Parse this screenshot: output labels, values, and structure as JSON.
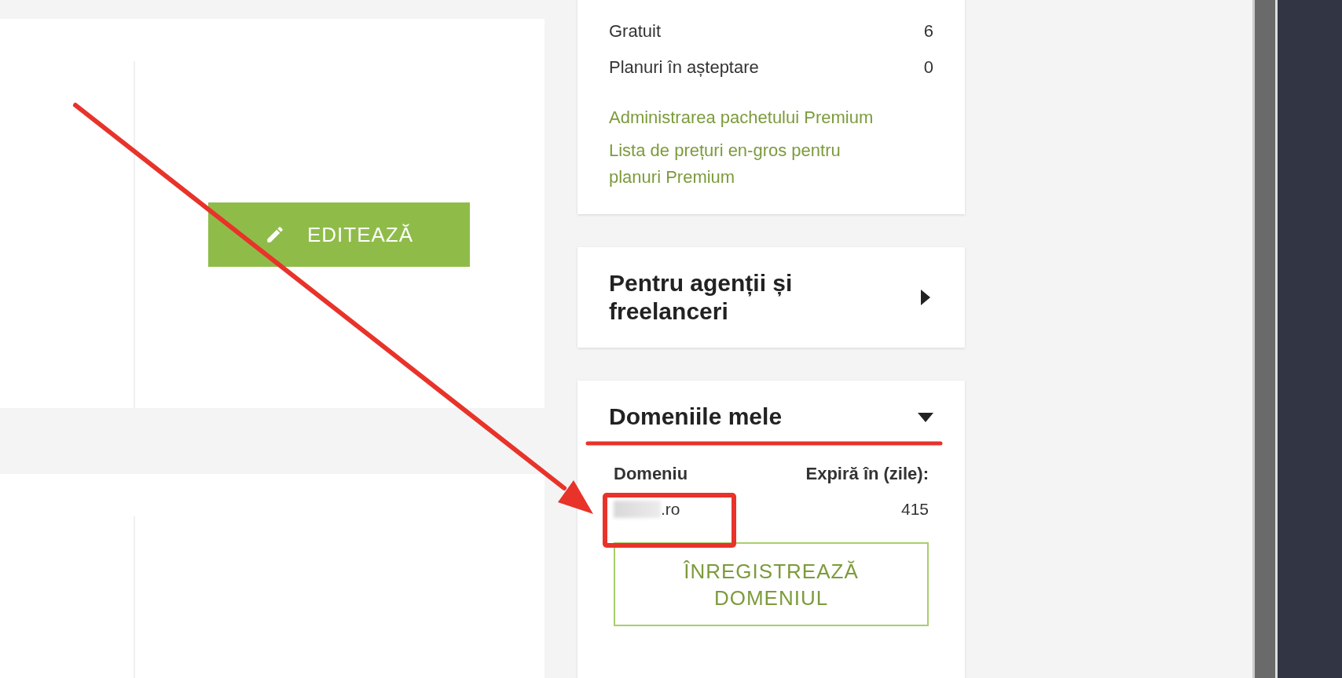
{
  "main_card": {
    "edit_button": "EDITEAZĂ"
  },
  "plans_card": {
    "rows": [
      {
        "label": "Gratuit",
        "value": "6"
      },
      {
        "label": "Planuri în așteptare",
        "value": "0"
      }
    ],
    "links": [
      "Administrarea pachetului Premium",
      "Lista de prețuri en-gros pentru planuri Premium"
    ]
  },
  "agencies_card": {
    "title": "Pentru agenții și freelanceri",
    "expanded": false
  },
  "domains_card": {
    "title": "Domeniile mele",
    "expanded": true,
    "columns": [
      "Domeniu",
      "Expiră în (zile):"
    ],
    "rows": [
      {
        "domain": ".ro",
        "expires": "415"
      }
    ],
    "register_button": "ÎNREGISTREAZĂ DOMENIUL"
  }
}
